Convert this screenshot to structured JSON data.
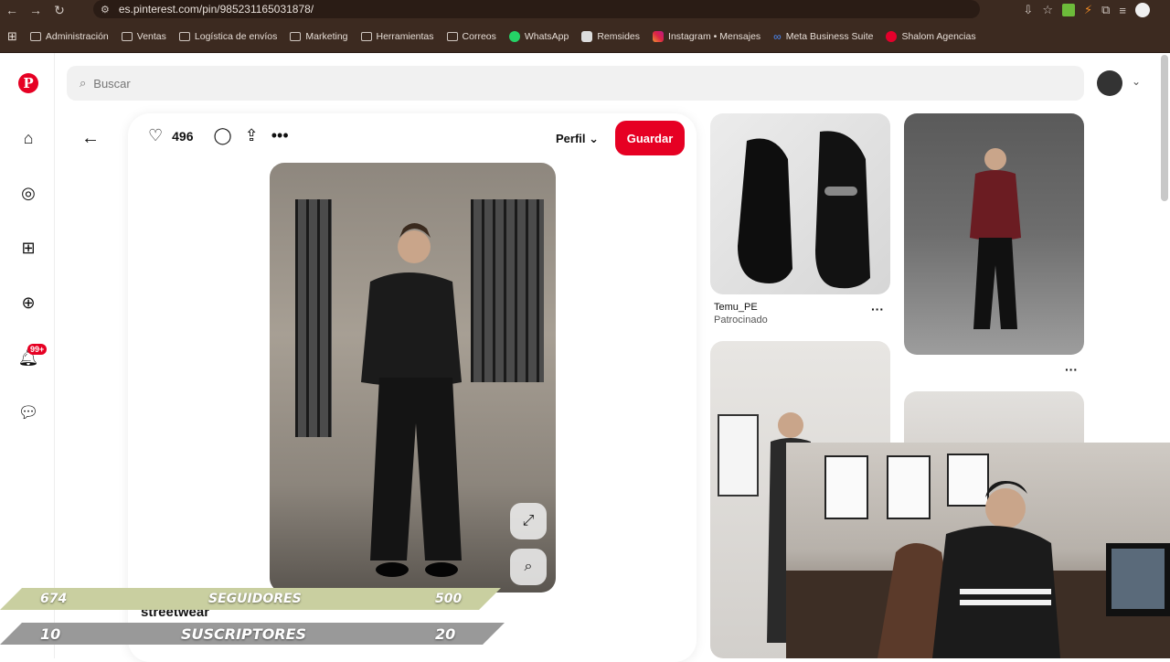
{
  "browser": {
    "url": "es.pinterest.com/pin/985231165031878/",
    "bookmarks": [
      {
        "label": "Administración"
      },
      {
        "label": "Ventas"
      },
      {
        "label": "Logística de envíos"
      },
      {
        "label": "Marketing"
      },
      {
        "label": "Herramientas"
      },
      {
        "label": "Correos"
      },
      {
        "label": "WhatsApp"
      },
      {
        "label": "Remsides"
      },
      {
        "label": "Instagram • Mensajes"
      },
      {
        "label": "Meta Business Suite"
      },
      {
        "label": "Shalom Agencias"
      }
    ]
  },
  "header": {
    "search_placeholder": "Buscar"
  },
  "sidebar": {
    "notifications_badge": "99+"
  },
  "pin": {
    "likes": "496",
    "profile_label": "Perfil",
    "save_label": "Guardar",
    "title": "streetwear"
  },
  "feed": {
    "ad_brand": "Temu_PE",
    "ad_sub": "Patrocinado",
    "more": "···"
  },
  "overlay": {
    "followers_current": "674",
    "followers_label": "SEGUIDORES",
    "followers_goal": "500",
    "subs_current": "10",
    "subs_label": "SUSCRIPTORES",
    "subs_goal": "20"
  },
  "colors": {
    "pinterest_red": "#e60023",
    "chrome_bg": "#3c2a20"
  }
}
